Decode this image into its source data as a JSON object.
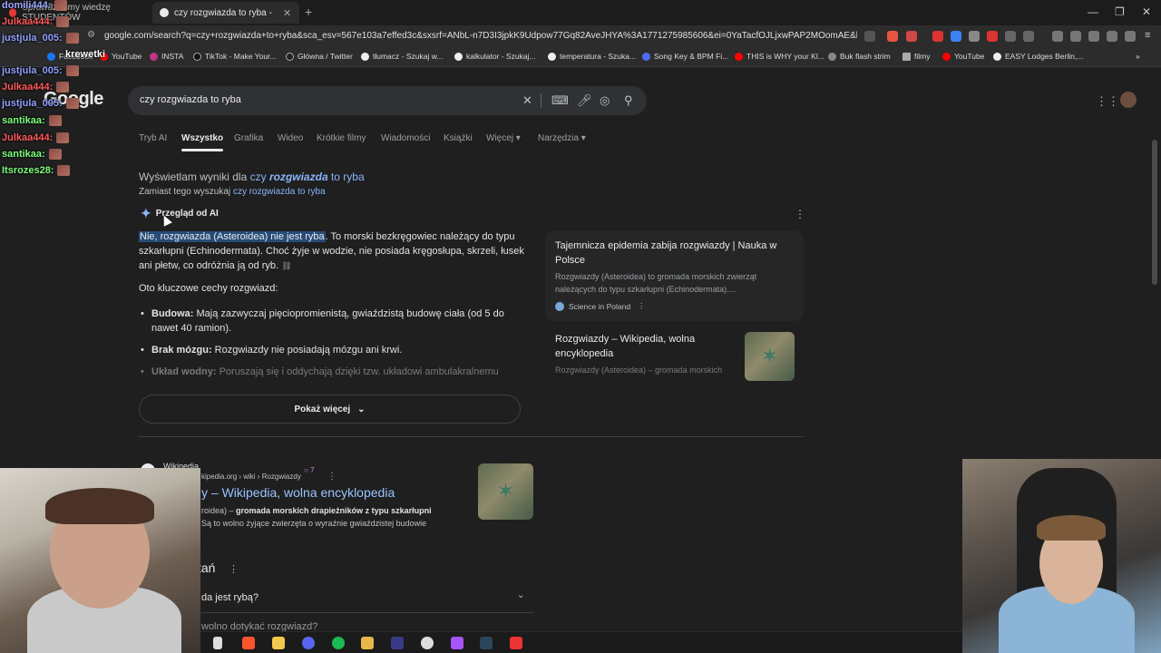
{
  "tabs": [
    {
      "label": "Sprawdziliśmy wiedzę STUDENTÓW",
      "active": false
    },
    {
      "label": "czy rozgwiazda to ryba - Szukaj",
      "active": true
    }
  ],
  "url": "google.com/search?q=czy+rozgwiazda+to+ryba&sca_esv=567e103a7effed3c&sxsrf=ANbL-n7D3I3jpkK9Udpow77Gq82AveJHYA%3A1771275985606&ei=0YaTacfOJLjxwPAP2MOomAE&biw=1920&bih...",
  "bookmarks": [
    "Facebook",
    "YouTube",
    "INSTA",
    "TikTok - Make Your...",
    "Główna / Twitter",
    "tłumacz - Szukaj w...",
    "kalkulator - Szukaj...",
    "temperatura - Szuka...",
    "Song Key & BPM Fi...",
    "THIS is WHY your Kl...",
    "Buk flash strim",
    "filmy",
    "YouTube",
    "EASY Lodges Berlin,..."
  ],
  "logo": "Google",
  "search": {
    "query": "czy rozgwiazda to ryba"
  },
  "nav_tabs": [
    "Tryb AI",
    "Wszystko",
    "Grafika",
    "Wideo",
    "Krótkie filmy",
    "Wiadomości",
    "Książki",
    "Więcej",
    "Narzędzia"
  ],
  "correction": {
    "showing_prefix": "Wyświetlam wyniki dla",
    "showing_a": "czy",
    "showing_b": "rozgwiazda",
    "showing_c": "to ryba",
    "instead_prefix": "Zamiast tego wyszukaj",
    "instead_link": "czy rozgwiazda to ryba"
  },
  "ai": {
    "header": "Przegląd od AI",
    "highlight": "Nie, rozgwiazda (Asteroidea) nie jest ryba",
    "rest": ". To morski bezkręgowiec należący do typu szkarłupni (Echinodermata). Choć żyje w wodzie, nie posiada kręgosłupa, skrzeli, łusek ani płetw, co odróżnia ją od ryb.",
    "subhead": "Oto kluczowe cechy rozgwiazd:",
    "bullets": [
      {
        "term": "Budowa:",
        "text": " Mają zazwyczaj pięciopromienistą, gwiaździstą budowę ciała (od 5 do nawet 40 ramion)."
      },
      {
        "term": "Brak mózgu:",
        "text": " Rozgwiazdy nie posiadają mózgu ani krwi."
      },
      {
        "term": "Układ wodny:",
        "text": " Poruszają się i oddychają dzięki tzw. układowi ambulakralnemu"
      }
    ],
    "show_more": "Pokaż więcej"
  },
  "sources": [
    {
      "title": "Tajemnicza epidemia zabija rozgwiazdy | Nauka w Polsce",
      "snippet": "Rozgwiazdy (Asteroidea) to gromada morskich zwierząt należących do typu szkarłupni (Echinodermata)....",
      "site": "Science in Poland"
    },
    {
      "title": "Rozgwiazdy – Wikipedia, wolna encyklopedia",
      "snippet": "Rozgwiazdy (Asteroidea) – gromada morskich"
    }
  ],
  "result": {
    "site": "Wikipedia",
    "path": "kipedia.org › wiki › Rozgwiazdy",
    "badge": "7",
    "title": "y – Wikipedia, wolna encyklopedia",
    "snippet_a": "roidea) – ",
    "snippet_bold": "gromada morskich drapieżników z typu szkarłupni",
    "snippet_b": "Są to wolno żyjące zwierzęta o wyraźnie gwiaździstej budowie"
  },
  "paa": {
    "title": "tań",
    "q1": "da jest rybą?",
    "q2": "wolno dotykać rozgwiazd?"
  },
  "chat": [
    {
      "user": "domili444:",
      "color": "#9aa7ff"
    },
    {
      "user": "Julkaa444:",
      "color": "#ff5a5a"
    },
    {
      "user": "justjula_005:",
      "color": "#8fa0ff"
    },
    {
      "user": "krewetki",
      "color": "#ffffff"
    },
    {
      "user": "justjula_005:",
      "color": "#8fa0ff"
    },
    {
      "user": "Julkaa444:",
      "color": "#ff5a5a"
    },
    {
      "user": "justjula_005:",
      "color": "#8fa0ff"
    },
    {
      "user": "santikaa:",
      "color": "#7dff7d"
    },
    {
      "user": "Julkaa444:",
      "color": "#ff5a5a"
    },
    {
      "user": "santikaa:",
      "color": "#7dff7d"
    },
    {
      "user": "Itsrozes28:",
      "color": "#7dff7d"
    }
  ]
}
